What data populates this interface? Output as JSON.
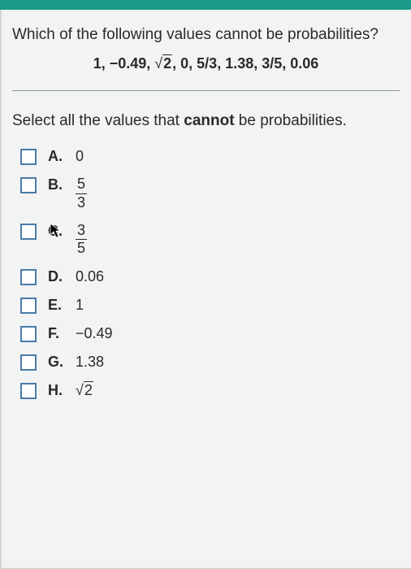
{
  "question": "Which of the following values cannot be probabilities?",
  "values_list": "1, −0.49, √2, 0, 5/3, 1.38, 3/5, 0.06",
  "values_parts": {
    "p1": "1, −0.49, ",
    "sqrt_arg": "2",
    "p2": ", 0, 5/3, 1.38, 3/5, 0.06"
  },
  "instruction_pre": "Select all the values that ",
  "instruction_bold": "cannot",
  "instruction_post": " be probabilities.",
  "options": {
    "A": {
      "letter": "A.",
      "text": "0"
    },
    "B": {
      "letter": "B.",
      "num": "5",
      "den": "3"
    },
    "C": {
      "letter": "C.",
      "num": "3",
      "den": "5"
    },
    "D": {
      "letter": "D.",
      "text": "0.06"
    },
    "E": {
      "letter": "E.",
      "text": "1"
    },
    "F": {
      "letter": "F.",
      "text": "−0.49"
    },
    "G": {
      "letter": "G.",
      "text": "1.38"
    },
    "H": {
      "letter": "H.",
      "sqrt_arg": "2"
    }
  }
}
